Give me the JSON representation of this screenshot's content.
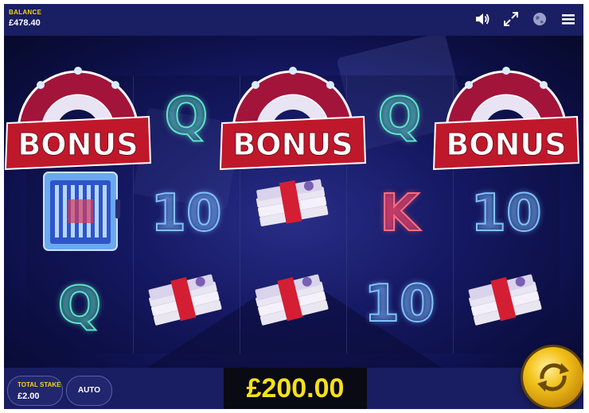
{
  "header": {
    "balance_label": "BALANCE",
    "balance_value": "£478.40",
    "icons": [
      "speaker-icon",
      "fullscreen-icon",
      "globe-icon",
      "menu-icon"
    ]
  },
  "reels": {
    "bonus_label": "BONUS",
    "columns": [
      [
        "bonus",
        "cash-vault",
        "Q"
      ],
      [
        "Q",
        "10",
        "cash-stack"
      ],
      [
        "bonus",
        "cash-stack",
        "cash-stack"
      ],
      [
        "Q",
        "K",
        "10"
      ],
      [
        "bonus",
        "10",
        "cash-stack"
      ]
    ]
  },
  "footer": {
    "total_stake_label": "TOTAL STAKE",
    "total_stake_value": "£2.00",
    "auto_label": "AUTO",
    "win_amount": "£200.00"
  },
  "colors": {
    "accent_yellow": "#f5e11c",
    "bar_navy": "#1a1e62",
    "bonus_red": "#c0182b",
    "symbol_teal": "#5fe3c6",
    "symbol_blue": "#7fc2ff",
    "symbol_red": "#ff6f7f"
  }
}
